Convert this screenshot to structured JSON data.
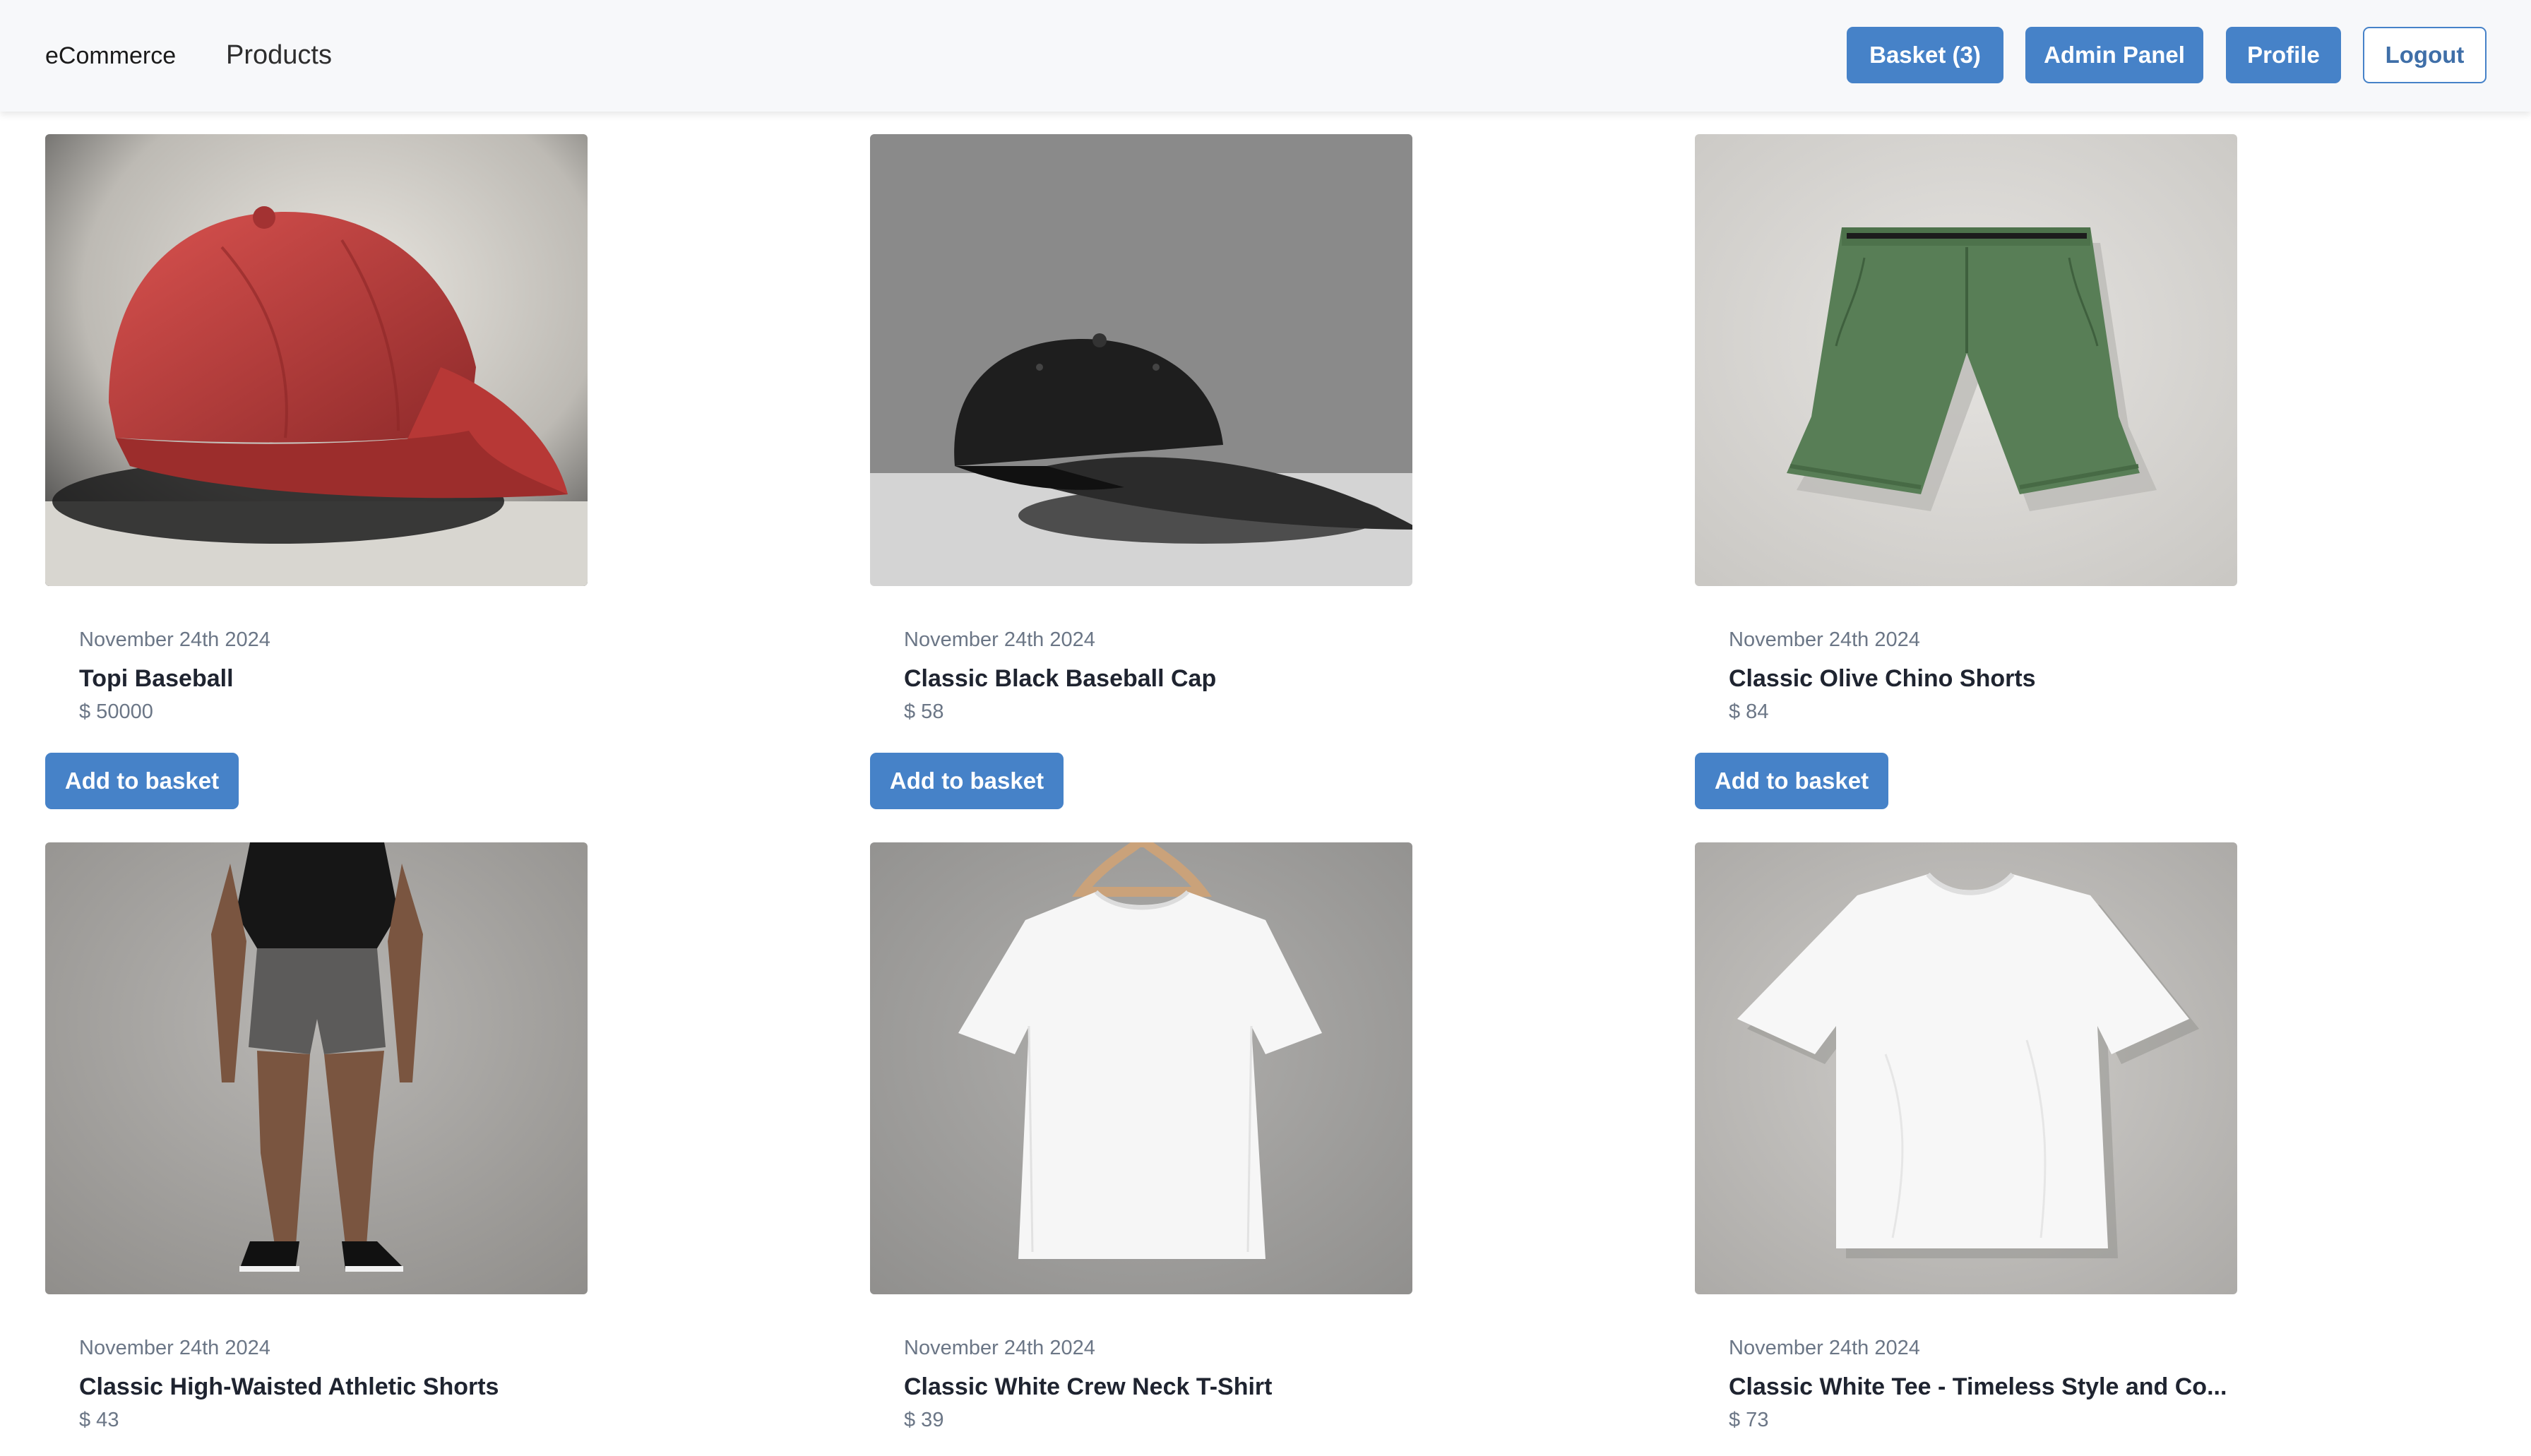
{
  "navbar": {
    "brand": "eCommerce",
    "nav_link": "Products",
    "buttons": {
      "basket": "Basket (3)",
      "admin": "Admin Panel",
      "profile": "Profile",
      "logout": "Logout"
    }
  },
  "colors": {
    "primary": "#4682c8",
    "navbar_bg": "#f7f8fa",
    "muted_text": "#6b7686"
  },
  "products": [
    {
      "image": "red-baseball-cap-photo",
      "date": "November 24th 2024",
      "name": "Topi Baseball",
      "price": "$ 50000",
      "button": "Add to basket"
    },
    {
      "image": "black-baseball-cap-photo",
      "date": "November 24th 2024",
      "name": "Classic Black Baseball Cap",
      "price": "$ 58",
      "button": "Add to basket"
    },
    {
      "image": "olive-chino-shorts-photo",
      "date": "November 24th 2024",
      "name": "Classic Olive Chino Shorts",
      "price": "$ 84",
      "button": "Add to basket"
    },
    {
      "image": "athletic-shorts-model-photo",
      "date": "November 24th 2024",
      "name": "Classic High-Waisted Athletic Shorts",
      "price": "$ 43"
    },
    {
      "image": "white-tshirt-on-hanger-photo",
      "date": "November 24th 2024",
      "name": "Classic White Crew Neck T-Shirt",
      "price": "$ 39"
    },
    {
      "image": "white-tee-flat-photo",
      "date": "November 24th 2024",
      "name": "Classic White Tee - Timeless Style and Co...",
      "price": "$ 73"
    }
  ]
}
